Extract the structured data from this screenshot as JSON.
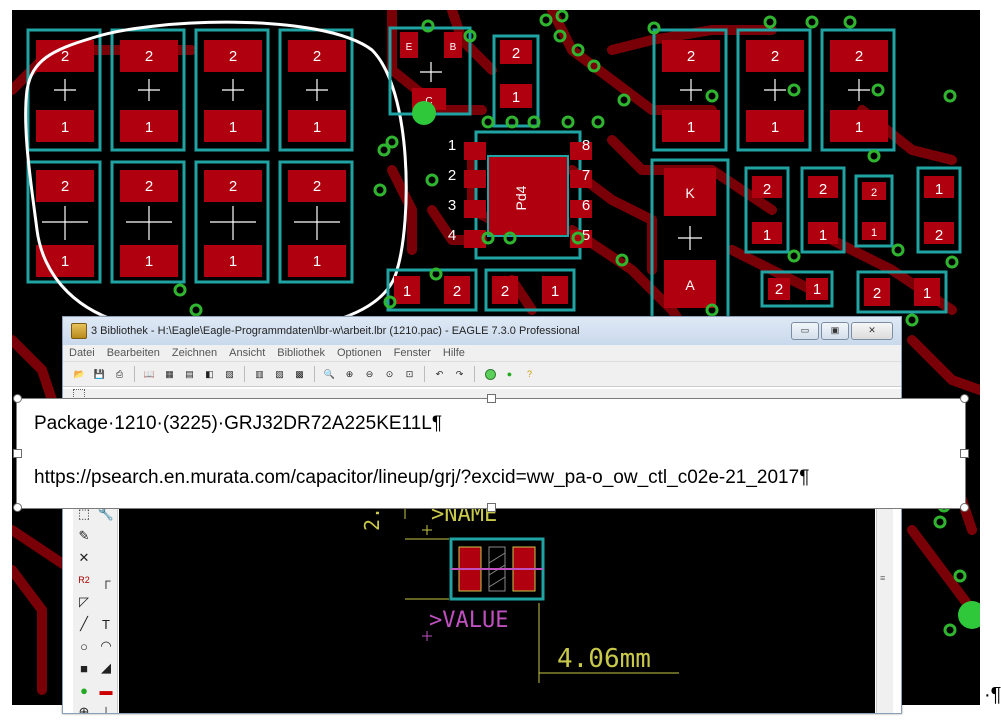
{
  "pcb": {
    "top_pads": [
      "2",
      "2",
      "2",
      "2"
    ],
    "top_pads_bottom": [
      "1",
      "1",
      "1",
      "1"
    ],
    "mid_pads_top": [
      "2",
      "2",
      "2",
      "2"
    ],
    "mid_pads_bottom": [
      "1",
      "1",
      "1",
      "1"
    ],
    "right_pads_top": [
      "2",
      "2",
      "2"
    ],
    "right_pads_bottom": [
      "1",
      "1",
      "1"
    ],
    "ic_pins_left": [
      "1",
      "2",
      "3",
      "4"
    ],
    "ic_pins_right": [
      "8",
      "7",
      "6",
      "5"
    ],
    "ic_label": "Pd4",
    "diode_k": "K",
    "diode_a": "A",
    "small_pad_E": "E",
    "small_pad_B": "B",
    "small_pad_C": "C",
    "row2_right": [
      "2",
      "1",
      "2",
      "1",
      "2",
      "1",
      "1",
      "2"
    ],
    "bottom_small": [
      "1",
      "2",
      "2",
      "1",
      "2",
      "1",
      "2",
      "1"
    ]
  },
  "window": {
    "title": "3 Bibliothek - H:\\Eagle\\Eagle-Programmdaten\\lbr-w\\arbeit.lbr (1210.pac) - EAGLE 7.3.0 Professional",
    "min_label": "▭",
    "max_label": "▣",
    "close_label": "✕",
    "menu": [
      "Datei",
      "Bearbeiten",
      "Zeichnen",
      "Ansicht",
      "Bibliothek",
      "Optionen",
      "Fenster",
      "Hilfe"
    ]
  },
  "canvas": {
    "name_label": ">NAME",
    "value_label": ">VALUE",
    "dim_label": "4.06mm",
    "side_dim": "2."
  },
  "callout": {
    "line1": "Package·1210·(3225)·GRJ32DR72A225KE11L¶",
    "line2": "https://psearch.en.murata.com/capacitor/lineup/grj/?excid=ww_pa-o_ow_ctl_c02e-21_2017¶"
  },
  "pilcrow": "·¶",
  "colors": {
    "pad": "#b00010",
    "outline": "#1fa3a3",
    "trace": "#7a0008",
    "via": "#2fb52f",
    "silk": "#c8c84a",
    "value": "#c050c0"
  }
}
